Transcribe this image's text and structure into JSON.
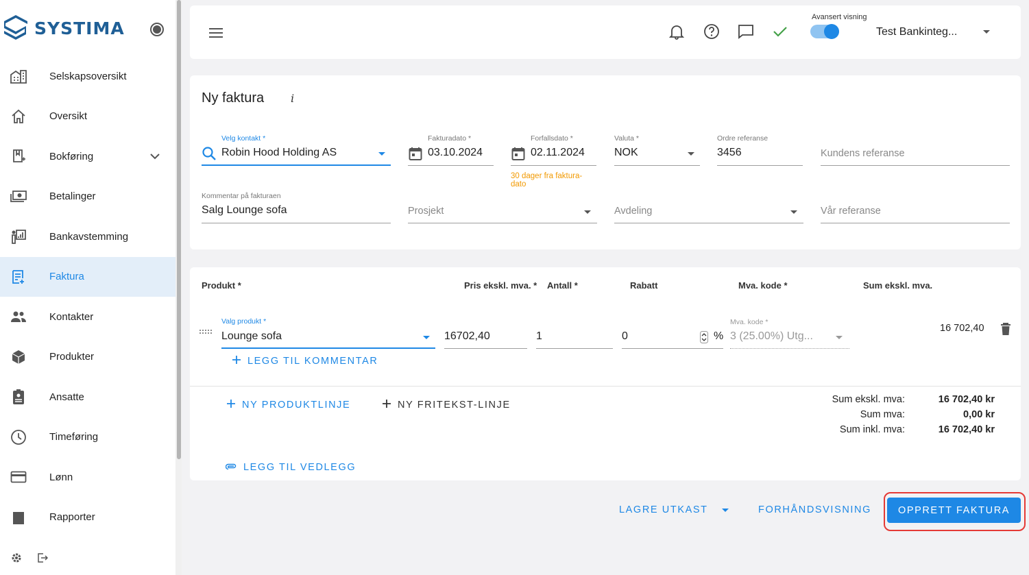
{
  "brand": {
    "name": "SYSTIMA",
    "color": "#1f5f96",
    "accent": "#1e88e5"
  },
  "sidebar": {
    "items": [
      {
        "label": "Selskapsoversikt",
        "icon": "company-icon"
      },
      {
        "label": "Oversikt",
        "icon": "home-icon"
      },
      {
        "label": "Bokføring",
        "icon": "ledger-icon",
        "expandable": true
      },
      {
        "label": "Betalinger",
        "icon": "payment-icon"
      },
      {
        "label": "Bankavstemming",
        "icon": "bank-reconcile-icon"
      },
      {
        "label": "Faktura",
        "icon": "invoice-icon",
        "active": true
      },
      {
        "label": "Kontakter",
        "icon": "contacts-icon"
      },
      {
        "label": "Produkter",
        "icon": "product-icon"
      },
      {
        "label": "Ansatte",
        "icon": "employee-icon"
      },
      {
        "label": "Timeføring",
        "icon": "clock-icon"
      },
      {
        "label": "Lønn",
        "icon": "card-icon"
      },
      {
        "label": "Rapporter",
        "icon": "report-icon"
      }
    ]
  },
  "topbar": {
    "advanced_label": "Avansert visning",
    "advanced_on": true,
    "company": "Test Bankinteg..."
  },
  "invoice": {
    "title": "Ny faktura",
    "info": "i",
    "contact": {
      "label": "Velg kontakt *",
      "value": "Robin Hood Holding AS"
    },
    "invoice_date": {
      "label": "Fakturadato *",
      "value": "03.10.2024"
    },
    "due_date": {
      "label": "Forfallsdato *",
      "value": "02.11.2024",
      "hint_line1": "30 dager fra faktura-",
      "hint_line2": "dato"
    },
    "currency": {
      "label": "Valuta *",
      "value": "NOK"
    },
    "order_ref": {
      "label": "Ordre referanse",
      "value": "3456"
    },
    "customer_ref": {
      "placeholder": "Kundens referanse"
    },
    "comment": {
      "label": "Kommentar på fakturaen",
      "value": "Salg Lounge sofa"
    },
    "project": {
      "placeholder": "Prosjekt"
    },
    "department": {
      "placeholder": "Avdeling"
    },
    "our_ref": {
      "placeholder": "Vår referanse"
    }
  },
  "lines": {
    "headers": {
      "product": "Produkt *",
      "price": "Pris ekskl. mva. *",
      "qty": "Antall *",
      "discount": "Rabatt",
      "vat": "Mva. kode *",
      "sum": "Sum ekskl. mva."
    },
    "row": {
      "product_label": "Valg produkt *",
      "product": "Lounge sofa",
      "price": "16702,40",
      "qty": "1",
      "discount": "0",
      "percent": "%",
      "vat_label": "Mva. kode *",
      "vat": "3 (25.00%) Utg...",
      "sum": "16 702,40"
    },
    "add_comment": "LEGG TIL KOMMENTAR",
    "new_product_line": "NY PRODUKTLINJE",
    "new_text_line": "NY FRITEKST-LINJE",
    "add_attachment": "LEGG TIL VEDLEGG",
    "totals": {
      "excl_label": "Sum ekskl. mva:",
      "excl": "16 702,40 kr",
      "vat_label": "Sum mva:",
      "vat": "0,00 kr",
      "incl_label": "Sum inkl. mva:",
      "incl": "16 702,40 kr"
    }
  },
  "actions": {
    "save_draft": "LAGRE UTKAST",
    "preview": "FORHÅNDSVISNING",
    "create": "OPPRETT FAKTURA"
  }
}
